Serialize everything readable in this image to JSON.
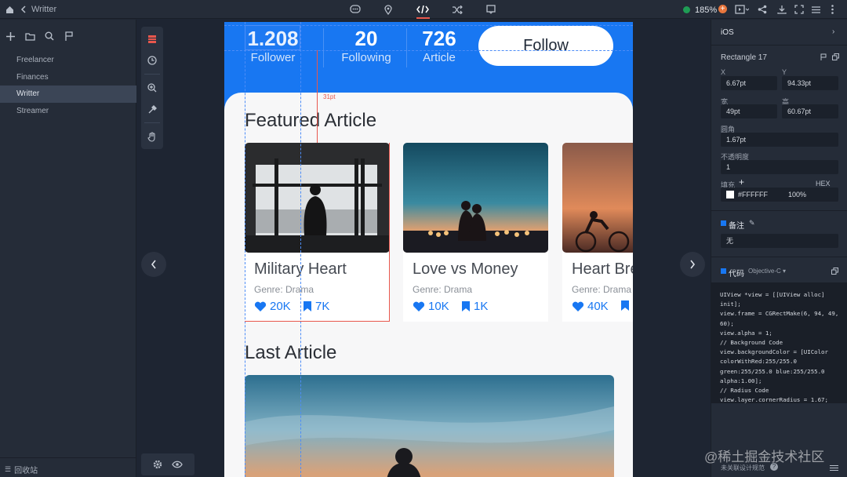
{
  "topbar": {
    "title": "Writter",
    "zoom": "185%",
    "icons": [
      "home-icon",
      "back-icon",
      "comment-icon",
      "pin-icon",
      "code-icon",
      "shuffle-icon",
      "frame-icon",
      "preview-icon",
      "share-icon",
      "download-icon",
      "fullscreen-icon",
      "menu-icon",
      "more-icon"
    ]
  },
  "sidebar": {
    "items": [
      {
        "label": "Freelancer"
      },
      {
        "label": "Finances"
      },
      {
        "label": "Writter"
      },
      {
        "label": "Streamer"
      }
    ],
    "trash_label": "回收站"
  },
  "phone": {
    "stats": [
      {
        "value": "1.208",
        "label": "Follower"
      },
      {
        "value": "20",
        "label": "Following"
      },
      {
        "value": "726",
        "label": "Article"
      }
    ],
    "follow_label": "Follow",
    "measure_label": "31pt",
    "featured_title": "Featured Article",
    "last_title": "Last Article",
    "cards": [
      {
        "title": "Military Heart",
        "genre": "Genre: Drama",
        "likes": "20K",
        "saves": "7K"
      },
      {
        "title": "Love vs Money",
        "genre": "Genre: Drama",
        "likes": "10K",
        "saves": "1K"
      },
      {
        "title": "Heart Bre",
        "genre": "Genre: Drama",
        "likes": "40K",
        "saves": ""
      }
    ]
  },
  "inspector": {
    "platform": "iOS",
    "layer_name": "Rectangle 17",
    "x_label": "X",
    "x_value": "6.67pt",
    "y_label": "Y",
    "y_value": "94.33pt",
    "w_label": "宽",
    "w_value": "49pt",
    "h_label": "高",
    "h_value": "60.67pt",
    "radius_label": "圆角",
    "radius_value": "1.67pt",
    "opacity_label": "不透明度",
    "opacity_value": "1",
    "fill_label": "填充",
    "fill_mode": "HEX",
    "fill_hex": "#FFFFFF",
    "fill_opacity": "100%",
    "note_label": "备注",
    "note_value": "无",
    "code_label": "代码",
    "code_lang": "Objective-C",
    "code": "UIView *view = [[UIView alloc] init];\nview.frame = CGRectMake(6, 94, 49, 60);\nview.alpha = 1;\n// Background Code\nview.backgroundColor = [UIColor colorWithRed:255/255.0 green:255/255.0 blue:255/255.0 alpha:1.00];\n// Radius Code\nview.layer.cornerRadius = 1.67;",
    "footer": "未关联设计规范"
  },
  "watermark": "@稀土掘金技术社区",
  "colors": {
    "accent": "#1877f2",
    "panel": "#252c38",
    "canvas": "#1e2532"
  }
}
